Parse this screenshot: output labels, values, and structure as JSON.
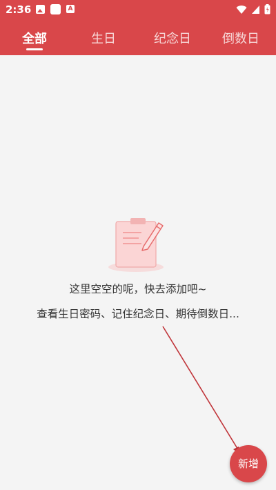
{
  "status_bar": {
    "time": "2:36",
    "left_icons": [
      "gallery-icon",
      "square-icon",
      "a-text-icon"
    ],
    "right_icons": [
      "wifi-icon",
      "signal-icon",
      "battery-icon"
    ]
  },
  "tabs": [
    {
      "label": "全部",
      "active": true
    },
    {
      "label": "生日",
      "active": false
    },
    {
      "label": "纪念日",
      "active": false
    },
    {
      "label": "倒数日",
      "active": false
    }
  ],
  "empty_state": {
    "icon": "clipboard-pencil-icon",
    "line1": "这里空空的呢，快去添加吧~",
    "line2": "查看生日密码、记住纪念日、期待倒数日..."
  },
  "fab": {
    "label": "新增"
  },
  "colors": {
    "accent": "#d9474a",
    "background": "#f4f4f4",
    "text": "#333333",
    "arrow": "#c0353a"
  }
}
